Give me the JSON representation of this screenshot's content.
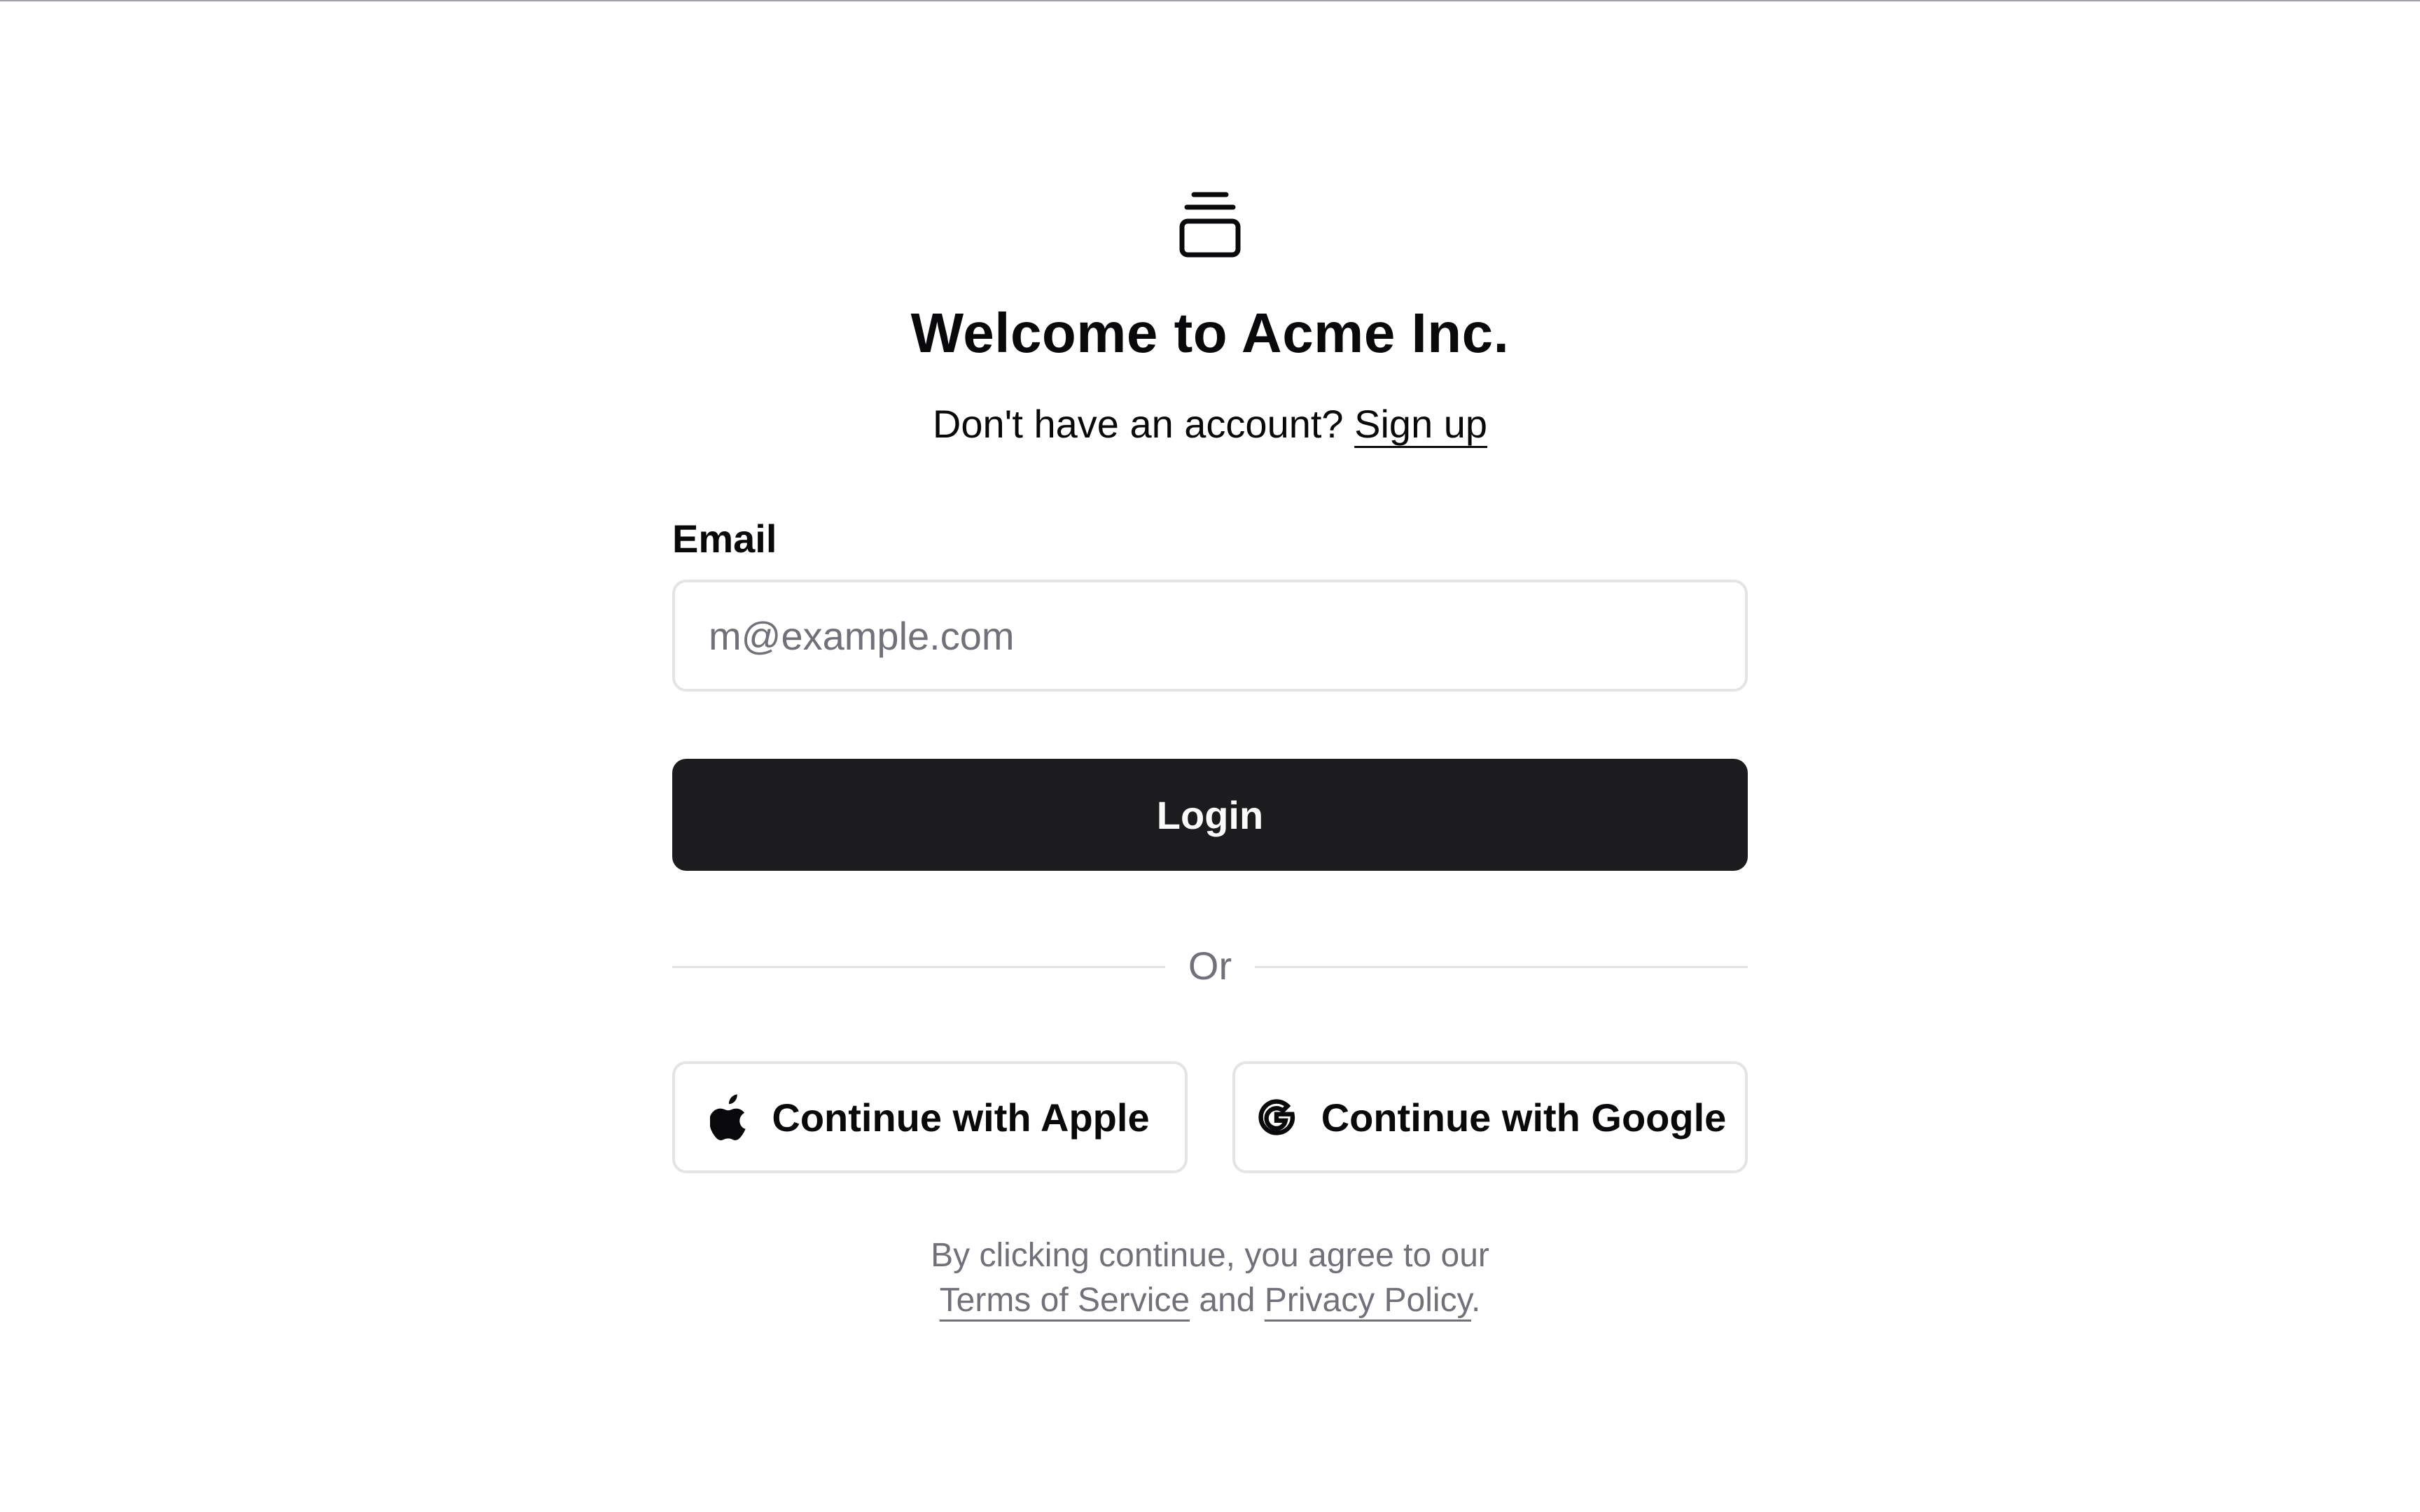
{
  "logo": {
    "icon": "stacked-box-icon"
  },
  "header": {
    "title": "Welcome to Acme Inc.",
    "signup_prompt": "Don't have an account?",
    "signup_link": "Sign up"
  },
  "form": {
    "email_label": "Email",
    "email_placeholder": "m@example.com",
    "email_value": "",
    "login_label": "Login"
  },
  "divider": {
    "label": "Or"
  },
  "social": {
    "apple": {
      "label": "Continue with Apple",
      "icon": "apple-icon"
    },
    "google": {
      "label": "Continue with Google",
      "icon": "google-icon"
    }
  },
  "legal": {
    "prefix": "By clicking continue, you agree to our",
    "terms_link": "Terms of Service",
    "conjunction": "and",
    "privacy_link": "Privacy Policy",
    "suffix": "."
  },
  "colors": {
    "primary_button": "#1c1c1e",
    "border": "#e4e4e7",
    "muted_text": "#71717a"
  }
}
